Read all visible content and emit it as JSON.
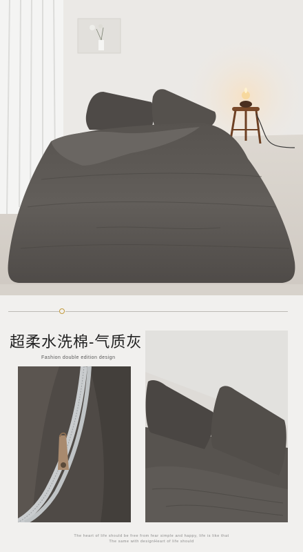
{
  "colors": {
    "background": "#f1f0ee",
    "bedding": "#5d5956",
    "accent_gold": "#c39a3c",
    "divider": "#bdbab5",
    "title_text": "#222222"
  },
  "product": {
    "title_zh": "超柔水洗棉-气质灰",
    "subtitle_en": "Fashion double edition design"
  },
  "footer": {
    "line1": "The heart of life should be free from fear simple and happy, life is like that",
    "line2": "The same with designHeart of life should"
  },
  "images": {
    "hero": "bedroom-scene-photo",
    "detail_zipper": "zipper-closeup-photo",
    "detail_pillows": "pillows-closeup-photo"
  }
}
